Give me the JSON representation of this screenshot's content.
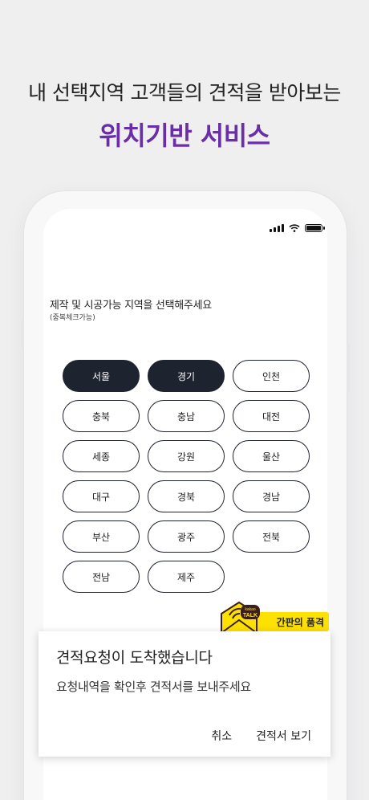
{
  "headline": "내 선택지역 고객들의 견적을 받아보는",
  "subheadline": "위치기반 서비스",
  "colors": {
    "accent": "#6a2fa8",
    "chip_selected": "#1e2330",
    "kakao_yellow": "#fde102"
  },
  "status_bar": {
    "icons": [
      "signal-icon",
      "wifi-icon",
      "battery-icon"
    ]
  },
  "instruction": {
    "title": "제작 및 시공가능 지역을 선택해주세요",
    "subtitle": "(중복체크가능)"
  },
  "regions": [
    {
      "label": "서울",
      "selected": true
    },
    {
      "label": "경기",
      "selected": true
    },
    {
      "label": "인천",
      "selected": false
    },
    {
      "label": "충북",
      "selected": false
    },
    {
      "label": "충남",
      "selected": false
    },
    {
      "label": "대전",
      "selected": false
    },
    {
      "label": "세종",
      "selected": false
    },
    {
      "label": "강원",
      "selected": false
    },
    {
      "label": "울산",
      "selected": false
    },
    {
      "label": "대구",
      "selected": false
    },
    {
      "label": "경북",
      "selected": false
    },
    {
      "label": "경남",
      "selected": false
    },
    {
      "label": "부산",
      "selected": false
    },
    {
      "label": "광주",
      "selected": false
    },
    {
      "label": "전북",
      "selected": false
    },
    {
      "label": "전남",
      "selected": false
    },
    {
      "label": "제주",
      "selected": false
    }
  ],
  "kakao_notice": {
    "badge_line1": "kakao",
    "badge_line2": "TALK",
    "label": "간판의 품격"
  },
  "dialog": {
    "title": "견적요청이 도착했습니다",
    "body": "요청내역을 확인후 견적서를 보내주세요",
    "cancel": "취소",
    "confirm": "견적서 보기"
  }
}
